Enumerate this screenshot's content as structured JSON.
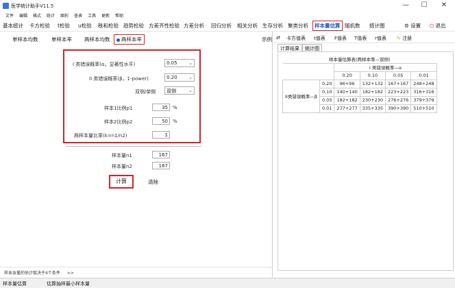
{
  "window": {
    "title": "医学统计助手V11.5",
    "minimize": "—",
    "maximize": "☐",
    "close": "✕"
  },
  "menu": [
    "文件",
    "编辑",
    "格式",
    "统计",
    "图形",
    "查表",
    "工具",
    "更新",
    "帮助"
  ],
  "toolbar": {
    "items": [
      "基本统计",
      "卡方检验",
      "t检验",
      "u检验",
      "秩和检验",
      "趋势检验",
      "方差齐性检验",
      "方差分析",
      "回归分析",
      "相关分析",
      "生存分析",
      "聚类分析",
      "样本量估算",
      "随机数",
      "统计图"
    ],
    "active": "样本量估算",
    "settings": "设置",
    "exit": "退出"
  },
  "subtabs": {
    "items": [
      "单样本均数",
      "单样本率",
      "两样本均数",
      "两样本率"
    ],
    "selected": "两样本率",
    "example": "示例"
  },
  "form": {
    "alpha_label": "I 类错误概率(α，显著性水平)",
    "alpha_value": "0.05",
    "beta_label": "II 类错误概率(β，1-power)",
    "beta_value": "0.20",
    "sides_label": "双侧/单侧",
    "sides_value": "双侧",
    "p1_label": "样本1比例p1",
    "p1_value": "35",
    "p1_unit": "%",
    "p2_label": "样本2比例p2",
    "p2_value": "50",
    "p2_unit": "%",
    "k_label": "两样本量比率(k=n1/n2)",
    "k_value": "1",
    "n1_label": "样本量n1",
    "n1_value": "167",
    "n2_label": "样本量n2",
    "n2_value": "167",
    "calc_button": "计算",
    "clear_button": "清除"
  },
  "footnote": {
    "text": "样本含量的估计取决于4个条件",
    "arrow": ">>"
  },
  "status": {
    "left": "样本量估算",
    "right": "估算抽样最小样本量"
  },
  "right_toolbar": {
    "items": [
      "卡方值表",
      "t值表",
      "F值表",
      "T值表",
      "r值表"
    ],
    "register": "注册"
  },
  "result_tabs": [
    "计算结果",
    "统计图"
  ],
  "result_table": {
    "title": "样本量估算表(两样本率—双侧)",
    "alpha_header": "I 类错误概率—α",
    "beta_header": "II类错误概率—β",
    "alphas": [
      "0.20",
      "0.10",
      "0.05",
      "0.01"
    ],
    "rows": [
      {
        "beta": "0.20",
        "cells": [
          "96+96",
          "132+132",
          "167+167",
          "248+248"
        ]
      },
      {
        "beta": "0.10",
        "cells": [
          "140+140",
          "182+182",
          "223+223",
          "316+316"
        ]
      },
      {
        "beta": "0.05",
        "cells": [
          "182+182",
          "230+230",
          "276+276",
          "379+379"
        ]
      },
      {
        "beta": "0.01",
        "cells": [
          "277+277",
          "335+335",
          "390+390",
          "510+510"
        ]
      }
    ]
  },
  "colors": {
    "highlight": "#d71f26",
    "accent": "#1a5fb4"
  }
}
